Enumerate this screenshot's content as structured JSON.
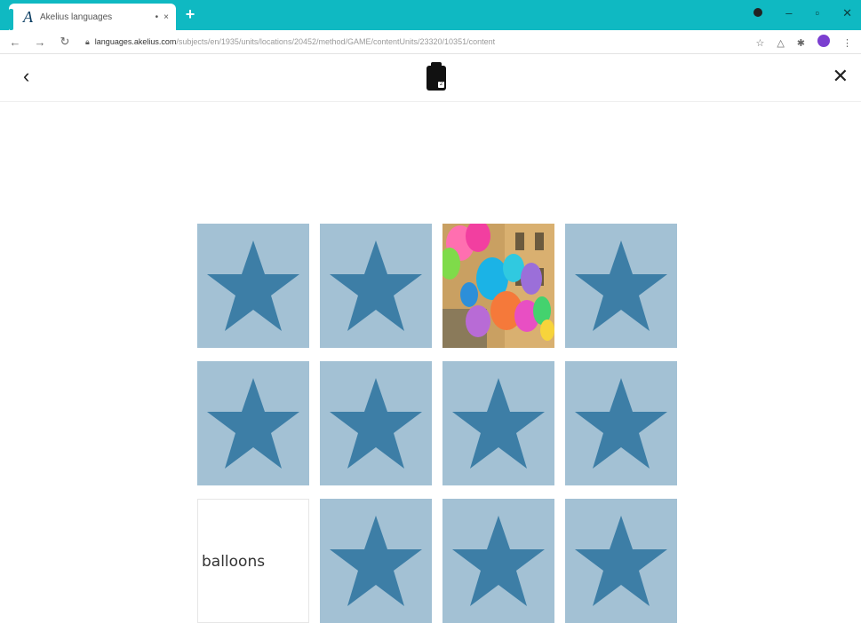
{
  "browser": {
    "tab_logo": "A",
    "tab_title": "Akelius languages",
    "tab_pin": "•",
    "tab_close": "×",
    "new_tab": "+",
    "url_host": "languages.akelius.com",
    "url_path": "/subjects/en/1935/units/locations/20452/method/GAME/contentUnits/23320/10351/content",
    "chrome_color": "#0fb9c2"
  },
  "header": {
    "back_icon": "‹",
    "close_icon": "✕",
    "badge": "2"
  },
  "game": {
    "card_color": "#a3c1d4",
    "star_color": "#3d7ea6",
    "cards": [
      {
        "type": "star"
      },
      {
        "type": "star"
      },
      {
        "type": "photo",
        "subject": "balloons"
      },
      {
        "type": "star"
      },
      {
        "type": "star"
      },
      {
        "type": "star"
      },
      {
        "type": "star"
      },
      {
        "type": "star"
      },
      {
        "type": "word",
        "text": "balloons"
      },
      {
        "type": "star"
      },
      {
        "type": "star"
      },
      {
        "type": "star"
      }
    ],
    "word_label": "balloons"
  }
}
